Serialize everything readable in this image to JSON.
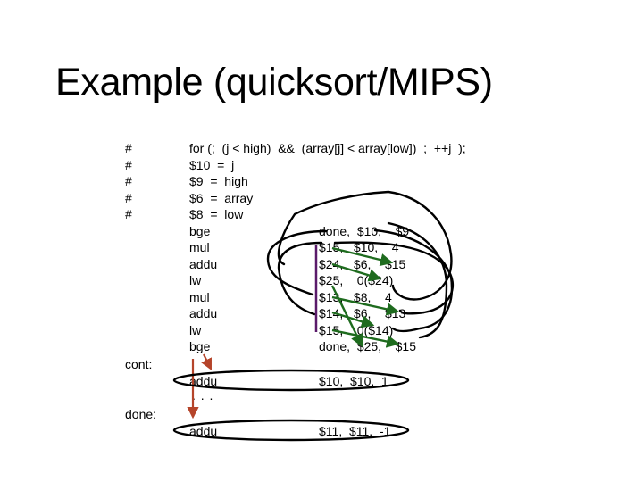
{
  "slide": {
    "title": "Example (quicksort/MIPS)"
  },
  "comments": [
    {
      "marker": "#",
      "text": "for (;  (j < high)  &&  (array[j] < array[low])  ;  ++j  );"
    },
    {
      "marker": "#",
      "text": "$10  =  j"
    },
    {
      "marker": "#",
      "text": "$9  =  high"
    },
    {
      "marker": "#",
      "text": "$6  =  array"
    },
    {
      "marker": "#",
      "text": "$8  =  low"
    }
  ],
  "loop_instructions": [
    {
      "op": "bge",
      "args": "done,  $10,    $9"
    },
    {
      "op": "mul",
      "args": "$15,   $10,    4"
    },
    {
      "op": "addu",
      "args": "$24,   $6,    $15"
    },
    {
      "op": "lw",
      "args": "$25,    0($24)"
    },
    {
      "op": "mul",
      "args": "$13,   $8,    4"
    },
    {
      "op": "addu",
      "args": "$14,   $6,    $13"
    },
    {
      "op": "lw",
      "args": "$15,    0($14)"
    },
    {
      "op": "bge",
      "args": "done,  $25,    $15"
    }
  ],
  "labels": {
    "cont": "cont:",
    "done": "done:"
  },
  "cont_block": {
    "op": "addu",
    "args": "$10,  $10,  1",
    "ellipsis": ". . ."
  },
  "done_block": {
    "op": "addu",
    "args": "$11,  $11,  -1"
  },
  "annotation_colors": {
    "loop_curves": "#000000",
    "dependency_arrows": "#1e6b1e",
    "control_flow_arrows": "#b5442a",
    "bracket_line": "#5a1a6a"
  }
}
